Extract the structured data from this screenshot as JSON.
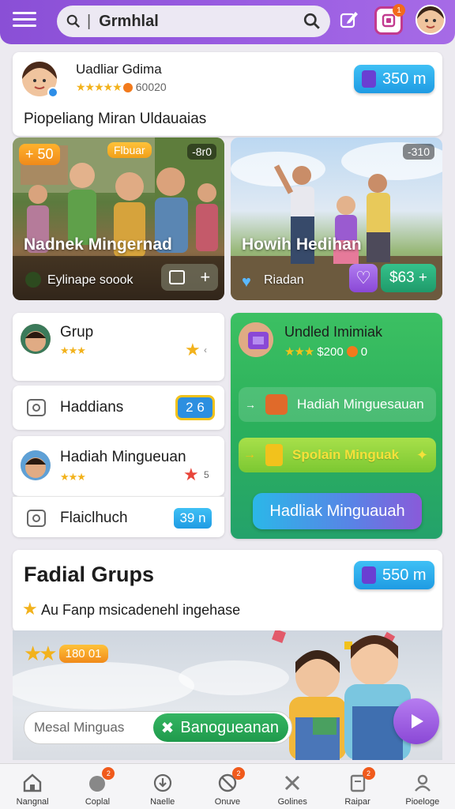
{
  "header": {
    "search_text": "Grmhlal",
    "gift_badge": "1"
  },
  "profile": {
    "name": "Uadliar Gdima",
    "stars": "★★★★★",
    "points": "60020",
    "subtitle": "Piopeliang Miran Uldauaias",
    "coins": "350 m"
  },
  "photo_a": {
    "tag_points": "+ 50",
    "tag_label": "Flbuar",
    "score": "-8r0",
    "title": "Nadnek Mingernad",
    "subtitle": "Eylinape soook"
  },
  "photo_b": {
    "score": "-310",
    "title": "Howih Hedihan",
    "subtitle": "Riadan",
    "price": "$63 +"
  },
  "list": {
    "group_label": "Grup",
    "group_stars": "★★★",
    "hadiah_label": "Haddians",
    "hadiah_badge": "2 6",
    "weekly_label": "Hadiah Mingueuan",
    "weekly_stars": "★★★",
    "weekly_count": "5",
    "flash_label": "Flaiclhuch",
    "flash_value": "39 n"
  },
  "green_card": {
    "title": "Undled Imimiak",
    "stars": "★★★",
    "amount": "$200",
    "zero": "0",
    "btn1": "Hadiah Minguesauan",
    "btn2": "Spolain Minguak",
    "btn3": "Hadliak Minguauah"
  },
  "grups": {
    "title": "Fadial Grups",
    "desc": "Au Fanp msicadenehl ingehase",
    "coins": "550 m"
  },
  "banner": {
    "points": "180 01",
    "input_placeholder": "Mesal Minguas",
    "go_label": "Banogueanan"
  },
  "nav": [
    {
      "label": "Nangnal",
      "badge": ""
    },
    {
      "label": "Coplal",
      "badge": "2"
    },
    {
      "label": "Naelle",
      "badge": ""
    },
    {
      "label": "Onuve",
      "badge": "2"
    },
    {
      "label": "Golines",
      "badge": ""
    },
    {
      "label": "Raipar",
      "badge": "2"
    },
    {
      "label": "Pioeloge",
      "badge": ""
    }
  ],
  "colors": {
    "header": "#9b5ee2",
    "accent_blue": "#1f9be3",
    "green": "#2bb05c",
    "purple": "#8a48d6"
  }
}
